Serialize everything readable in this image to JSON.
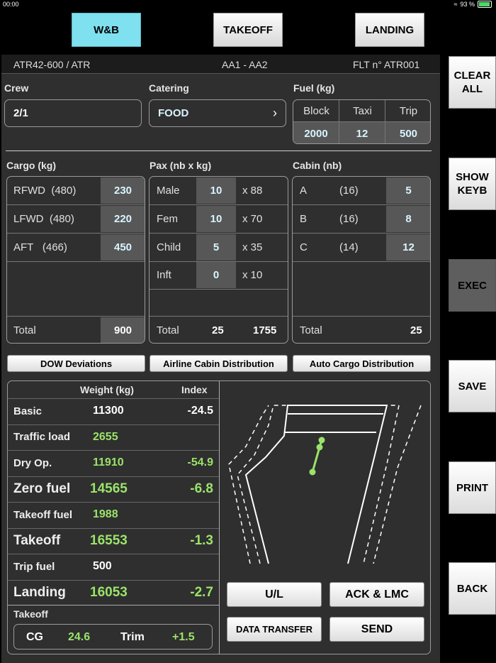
{
  "status": {
    "time": "00:00",
    "battery": "93 %",
    "battery_level": 0.93
  },
  "tabs": [
    "W&B",
    "TAKEOFF",
    "LANDING"
  ],
  "side_buttons": [
    "CLEAR\nALL",
    "SHOW\nKEYB",
    "EXEC",
    "SAVE",
    "PRINT",
    "BACK"
  ],
  "header": {
    "aircraft": "ATR42-600 / ATR",
    "route": "AA1 - AA2",
    "flight": "FLT n° ATR001"
  },
  "crew": {
    "label": "Crew",
    "value": "2/1"
  },
  "catering": {
    "label": "Catering",
    "value": "FOOD"
  },
  "fuel": {
    "label": "Fuel (kg)",
    "headers": [
      "Block",
      "Taxi",
      "Trip"
    ],
    "values": [
      "2000",
      "12",
      "500"
    ]
  },
  "cargo": {
    "label": "Cargo (kg)",
    "rows": [
      {
        "name": "RFWD",
        "cap": "(480)",
        "value": "230"
      },
      {
        "name": "LFWD",
        "cap": "(480)",
        "value": "220"
      },
      {
        "name": "AFT",
        "cap": "(466)",
        "value": "450"
      }
    ],
    "total_label": "Total",
    "total": "900"
  },
  "pax": {
    "label": "Pax (nb x kg)",
    "rows": [
      {
        "name": "Male",
        "nb": "10",
        "kg": "x 88"
      },
      {
        "name": "Fem",
        "nb": "10",
        "kg": "x 70"
      },
      {
        "name": "Child",
        "nb": "5",
        "kg": "x 35"
      },
      {
        "name": "Inft",
        "nb": "0",
        "kg": "x 10"
      }
    ],
    "total_label": "Total",
    "total_nb": "25",
    "total_kg": "1755"
  },
  "cabin": {
    "label": "Cabin (nb)",
    "rows": [
      {
        "name": "A",
        "cap": "(16)",
        "value": "5"
      },
      {
        "name": "B",
        "cap": "(16)",
        "value": "8"
      },
      {
        "name": "C",
        "cap": "(14)",
        "value": "12"
      }
    ],
    "total_label": "Total",
    "total": "25"
  },
  "buttons": {
    "dow": "DOW Deviations",
    "airline": "Airline Cabin Distribution",
    "auto": "Auto Cargo Distribution"
  },
  "weights": {
    "col_weight": "Weight (kg)",
    "col_index": "Index",
    "rows": [
      {
        "name": "Basic",
        "weight": "11300",
        "index": "-24.5",
        "big": false,
        "green": false
      },
      {
        "name": "Traffic load",
        "weight": "2655",
        "index": "",
        "big": false,
        "green": true
      },
      {
        "name": "Dry Op.",
        "weight": "11910",
        "index": "-54.9",
        "big": false,
        "green": true
      },
      {
        "name": "Zero fuel",
        "weight": "14565",
        "index": "-6.8",
        "big": true,
        "green": true
      },
      {
        "name": "Takeoff fuel",
        "weight": "1988",
        "index": "",
        "big": false,
        "green": true
      },
      {
        "name": "Takeoff",
        "weight": "16553",
        "index": "-1.3",
        "big": true,
        "green": true
      },
      {
        "name": "Trip fuel",
        "weight": "500",
        "index": "",
        "big": false,
        "green": false
      },
      {
        "name": "Landing",
        "weight": "16053",
        "index": "-2.7",
        "big": true,
        "green": true
      }
    ]
  },
  "takeoff_box": {
    "label": "Takeoff",
    "cg_label": "CG",
    "cg": "24.6",
    "trim_label": "Trim",
    "trim": "+1.5"
  },
  "action_buttons": {
    "ul": "U/L",
    "ack": "ACK & LMC",
    "data": "DATA TRANSFER",
    "send": "SEND"
  },
  "colors": {
    "active_tab": "#7fe0ef",
    "green": "#9be36a",
    "value_text": "#d8f4ff"
  }
}
